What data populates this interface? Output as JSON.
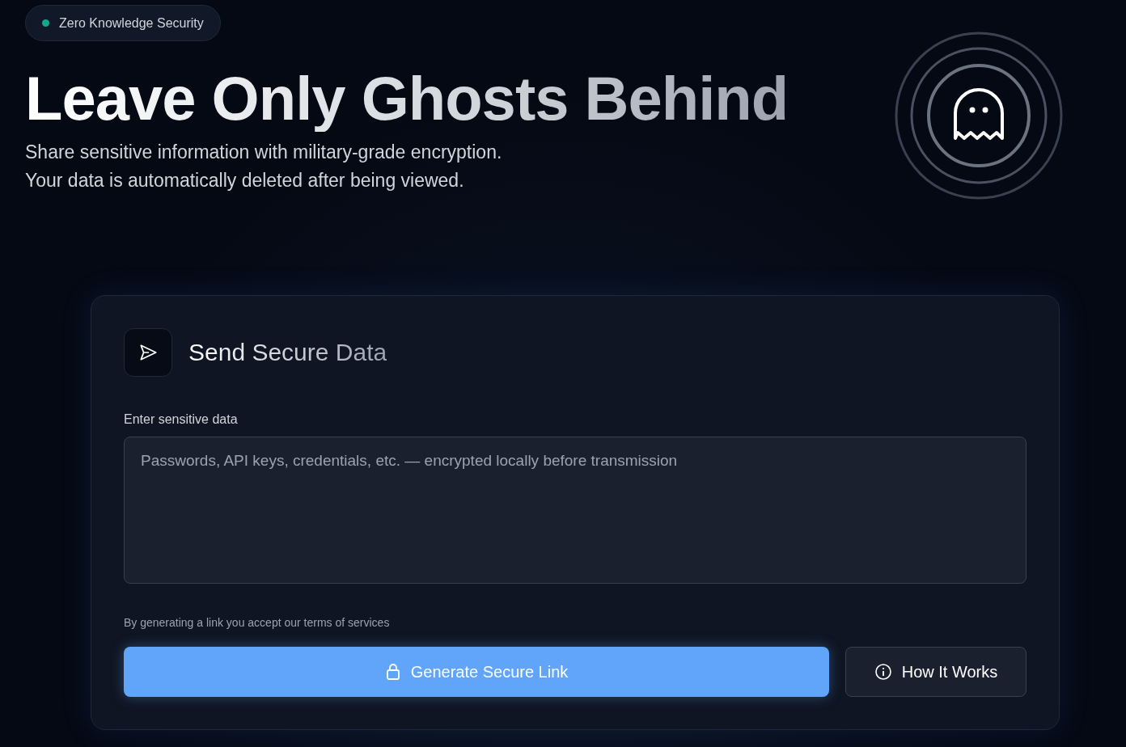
{
  "badge": {
    "label": "Zero Knowledge Security"
  },
  "hero": {
    "title": "Leave Only Ghosts Behind",
    "subtitle_lines": [
      "Share sensitive information with military-grade encryption.",
      "Your data is automatically deleted after being viewed."
    ]
  },
  "card": {
    "title": "Send Secure Data",
    "field_label": "Enter sensitive data",
    "placeholder": "Passwords, API keys, credentials, etc. — encrypted locally before transmission",
    "terms": "By generating a link you accept our terms of services",
    "buttons": [
      {
        "kind": "primary",
        "label": "Generate Secure Link"
      },
      {
        "kind": "secondary",
        "label": "How It Works"
      }
    ]
  }
}
